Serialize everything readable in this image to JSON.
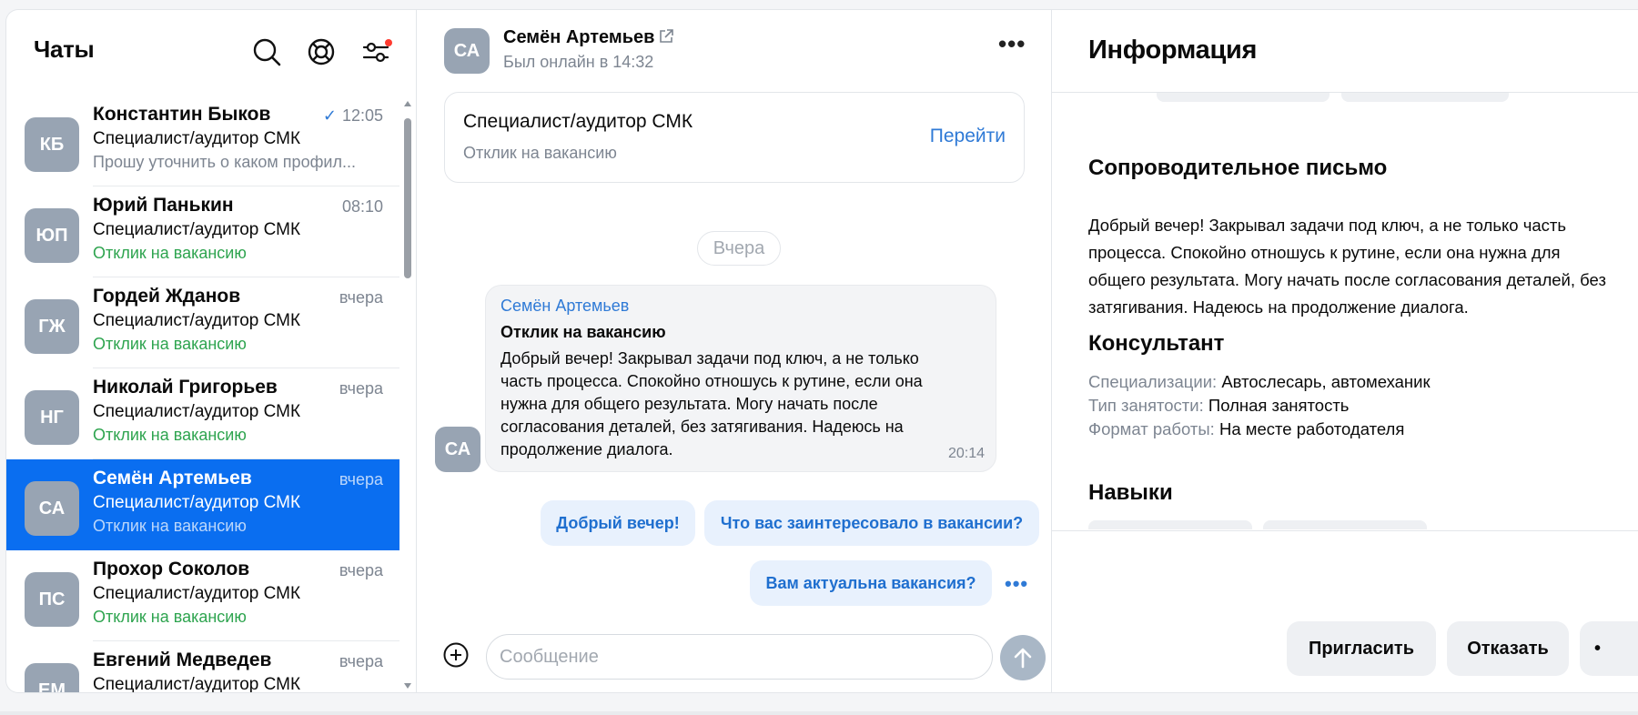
{
  "chats": {
    "title": "Чаты",
    "items": [
      {
        "initials": "КБ",
        "name": "Константин Быков",
        "time": "12:05",
        "read": true,
        "subtitle": "Специалист/аудитор СМК",
        "preview": "Прошу уточнить о каком профил...",
        "preview_style": "gray"
      },
      {
        "initials": "ЮП",
        "name": "Юрий Панькин",
        "time": "08:10",
        "subtitle": "Специалист/аудитор СМК",
        "preview": "Отклик на вакансию",
        "preview_style": "green"
      },
      {
        "initials": "ГЖ",
        "name": "Гордей Жданов",
        "time": "вчера",
        "subtitle": "Специалист/аудитор СМК",
        "preview": "Отклик на вакансию",
        "preview_style": "green"
      },
      {
        "initials": "НГ",
        "name": "Николай Григорьев",
        "time": "вчера",
        "subtitle": "Специалист/аудитор СМК",
        "preview": "Отклик на вакансию",
        "preview_style": "green"
      },
      {
        "initials": "СА",
        "name": "Семён Артемьев",
        "time": "вчера",
        "subtitle": "Специалист/аудитор СМК",
        "preview": "Отклик на вакансию",
        "preview_style": "gray",
        "active": true
      },
      {
        "initials": "ПС",
        "name": "Прохор Соколов",
        "time": "вчера",
        "subtitle": "Специалист/аудитор СМК",
        "preview": "Отклик на вакансию",
        "preview_style": "green"
      },
      {
        "initials": "ЕМ",
        "name": "Евгений Медведев",
        "time": "вчера",
        "subtitle": "Специалист/аудитор СМК",
        "preview": "",
        "preview_style": "green"
      }
    ]
  },
  "conversation": {
    "initials": "СА",
    "name": "Семён Артемьев",
    "status": "Был онлайн в 14:32",
    "vacancy": {
      "title": "Специалист/аудитор СМК",
      "subtitle": "Отклик на вакансию",
      "action": "Перейти"
    },
    "date_divider": "Вчера",
    "message": {
      "author": "Семён Артемьев",
      "heading": "Отклик на вакансию",
      "text": "Добрый вечер! Закрывал задачи под ключ, а не только часть процесса. Спокойно отношусь к рутине, если она нужна для общего результата. Могу начать после согласования деталей, без затягивания. Надеюсь на продолжение диалога.",
      "time": "20:14"
    },
    "quick_replies": [
      "Добрый вечер!",
      "Что вас заинтересовало в вакансии?",
      "Вам актуальна вакансия?"
    ],
    "input_placeholder": "Сообщение"
  },
  "info": {
    "title": "Информация",
    "cover_letter": {
      "title": "Сопроводительное письмо",
      "text": "Добрый вечер! Закрывал задачи под ключ, а не только часть процесса. Спокойно отношусь к рутине, если она нужна для общего результата. Могу начать после согласования деталей, без затягивания. Надеюсь на продолжение диалога."
    },
    "consultant": {
      "title": "Консультант",
      "specializations_label": "Специализации:",
      "specializations_value": "Автослесарь, автомеханик",
      "employment_label": "Тип занятости:",
      "employment_value": "Полная занятость",
      "format_label": "Формат работы:",
      "format_value": "На месте работодателя"
    },
    "skills_title": "Навыки",
    "actions": {
      "invite": "Пригласить",
      "reject": "Отказать",
      "more": "•"
    }
  },
  "colors": {
    "accent": "#0a6ef0",
    "link": "#2f7ad6",
    "status_green": "#2ea44f",
    "avatar": "#98a4b3",
    "unread_dot": "#ff3b30"
  },
  "icons": [
    "search-icon",
    "support-icon",
    "filter-icon",
    "external-link-icon",
    "more-icon",
    "plus-circle-icon",
    "send-arrow-icon"
  ]
}
